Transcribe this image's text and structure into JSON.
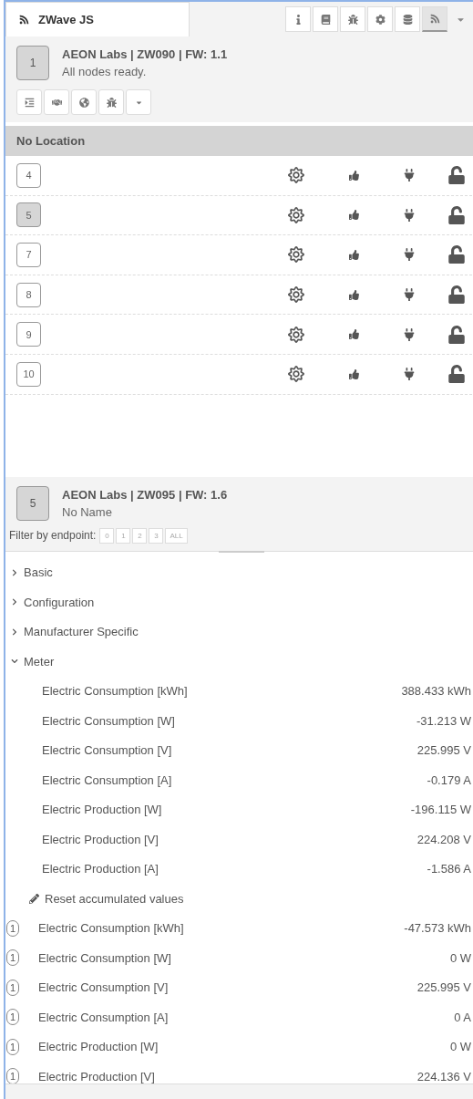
{
  "tab": {
    "title": "ZWave JS",
    "selected": true
  },
  "sidebar_buttons": [
    {
      "kind": "info",
      "selected": false
    },
    {
      "kind": "book",
      "selected": false
    },
    {
      "kind": "bug",
      "selected": false
    },
    {
      "kind": "cog",
      "selected": false
    },
    {
      "kind": "database",
      "selected": false
    },
    {
      "kind": "feed",
      "selected": true
    }
  ],
  "controller": {
    "node_id": "1",
    "title": "AEON Labs | ZW090 | FW: 1.1",
    "status": "All nodes ready."
  },
  "location": "No Location",
  "nodes": [
    {
      "id": "4",
      "selected": false
    },
    {
      "id": "5",
      "selected": true
    },
    {
      "id": "7",
      "selected": false
    },
    {
      "id": "8",
      "selected": false
    },
    {
      "id": "9",
      "selected": false
    },
    {
      "id": "10",
      "selected": false
    }
  ],
  "node": {
    "node_id": "5",
    "title": "AEON Labs | ZW095 | FW: 1.6",
    "name": "No Name",
    "filter_label": "Filter by endpoint:",
    "endpoints": [
      "0",
      "1",
      "2",
      "3",
      "ALL"
    ]
  },
  "classes": [
    {
      "name": "Basic",
      "expanded": false
    },
    {
      "name": "Configuration",
      "expanded": false
    },
    {
      "name": "Manufacturer Specific",
      "expanded": false
    },
    {
      "name": "Meter",
      "expanded": true
    }
  ],
  "values": [
    {
      "kind": "value",
      "label": "Electric Consumption [kWh]",
      "value": "388.433 kWh"
    },
    {
      "kind": "value",
      "label": "Electric Consumption [W]",
      "value": "-31.213 W"
    },
    {
      "kind": "value",
      "label": "Electric Consumption [V]",
      "value": "225.995 V"
    },
    {
      "kind": "value",
      "label": "Electric Consumption [A]",
      "value": "-0.179 A"
    },
    {
      "kind": "value",
      "label": "Electric Production [W]",
      "value": "-196.115 W"
    },
    {
      "kind": "value",
      "label": "Electric Production [V]",
      "value": "224.208 V"
    },
    {
      "kind": "value",
      "label": "Electric Production [A]",
      "value": "-1.586 A"
    },
    {
      "kind": "action",
      "label": "Reset accumulated values"
    },
    {
      "kind": "value",
      "endpoint": "1",
      "label": "Electric Consumption [kWh]",
      "value": "-47.573 kWh"
    },
    {
      "kind": "value",
      "endpoint": "1",
      "label": "Electric Consumption [W]",
      "value": "0 W"
    },
    {
      "kind": "value",
      "endpoint": "1",
      "label": "Electric Consumption [V]",
      "value": "225.995 V"
    },
    {
      "kind": "value",
      "endpoint": "1",
      "label": "Electric Consumption [A]",
      "value": "0 A"
    },
    {
      "kind": "value",
      "endpoint": "1",
      "label": "Electric Production [W]",
      "value": "0 W"
    },
    {
      "kind": "value",
      "endpoint": "1",
      "label": "Electric Production [V]",
      "value": "224.136 V"
    }
  ]
}
